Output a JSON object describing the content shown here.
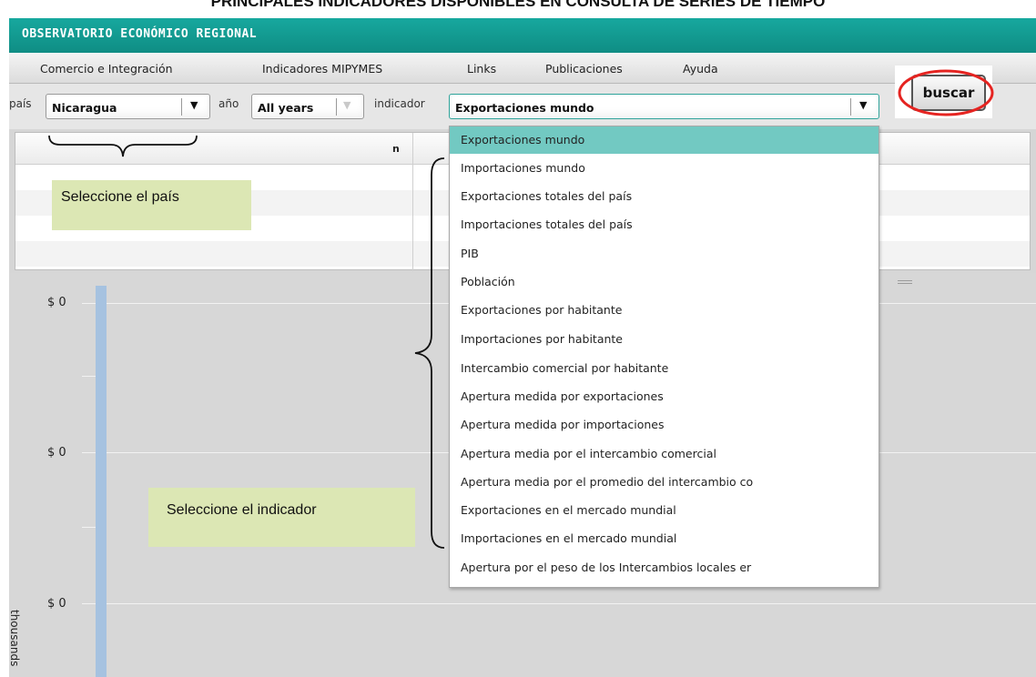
{
  "document": {
    "heading": "PRINCIPALES INDICADORES DISPONIBLES EN CONSULTA DE SERIES DE TIEMPO"
  },
  "app": {
    "title": "OBSERVATORIO ECONÓMICO REGIONAL"
  },
  "menu": {
    "items": [
      "Comercio e Integración",
      "Indicadores MIPYMES",
      "Links",
      "Publicaciones",
      "Ayuda"
    ]
  },
  "filters": {
    "country_label": "país",
    "country_value": "Nicaragua",
    "year_label": "año",
    "year_value": "All years",
    "indicator_label": "indicador",
    "indicator_value": "Exportaciones mundo",
    "search_button": "buscar"
  },
  "table": {
    "column_n": "n"
  },
  "chart": {
    "y_ticks": [
      "$ 0",
      "$ 0",
      "$ 0"
    ],
    "y_axis_label": "thousands"
  },
  "dropdown": {
    "selected_index": 0,
    "options": [
      "Exportaciones mundo",
      "Importaciones mundo",
      "Exportaciones totales del país",
      "Importaciones totales del país",
      "PIB",
      "Población",
      "Exportaciones por habitante",
      "Importaciones por habitante",
      "Intercambio comercial por habitante",
      "Apertura medida por exportaciones",
      "Apertura medida por importaciones",
      "Apertura media por el intercambio comercial",
      "Apertura media por el promedio del intercambio co",
      "Exportaciones en el mercado mundial",
      "Importaciones en el mercado mundial",
      "Apertura por el peso de los Intercambios locales er"
    ]
  },
  "annotations": {
    "select_country": "Seleccione el país",
    "select_indicator": "Seleccione el indicador",
    "highlight_color": "#e52421",
    "callout_color": "#dce7b4"
  },
  "colors": {
    "header": "#0f8d84",
    "selected_option": "#72c9c2",
    "bar": "#a6c2e0"
  }
}
